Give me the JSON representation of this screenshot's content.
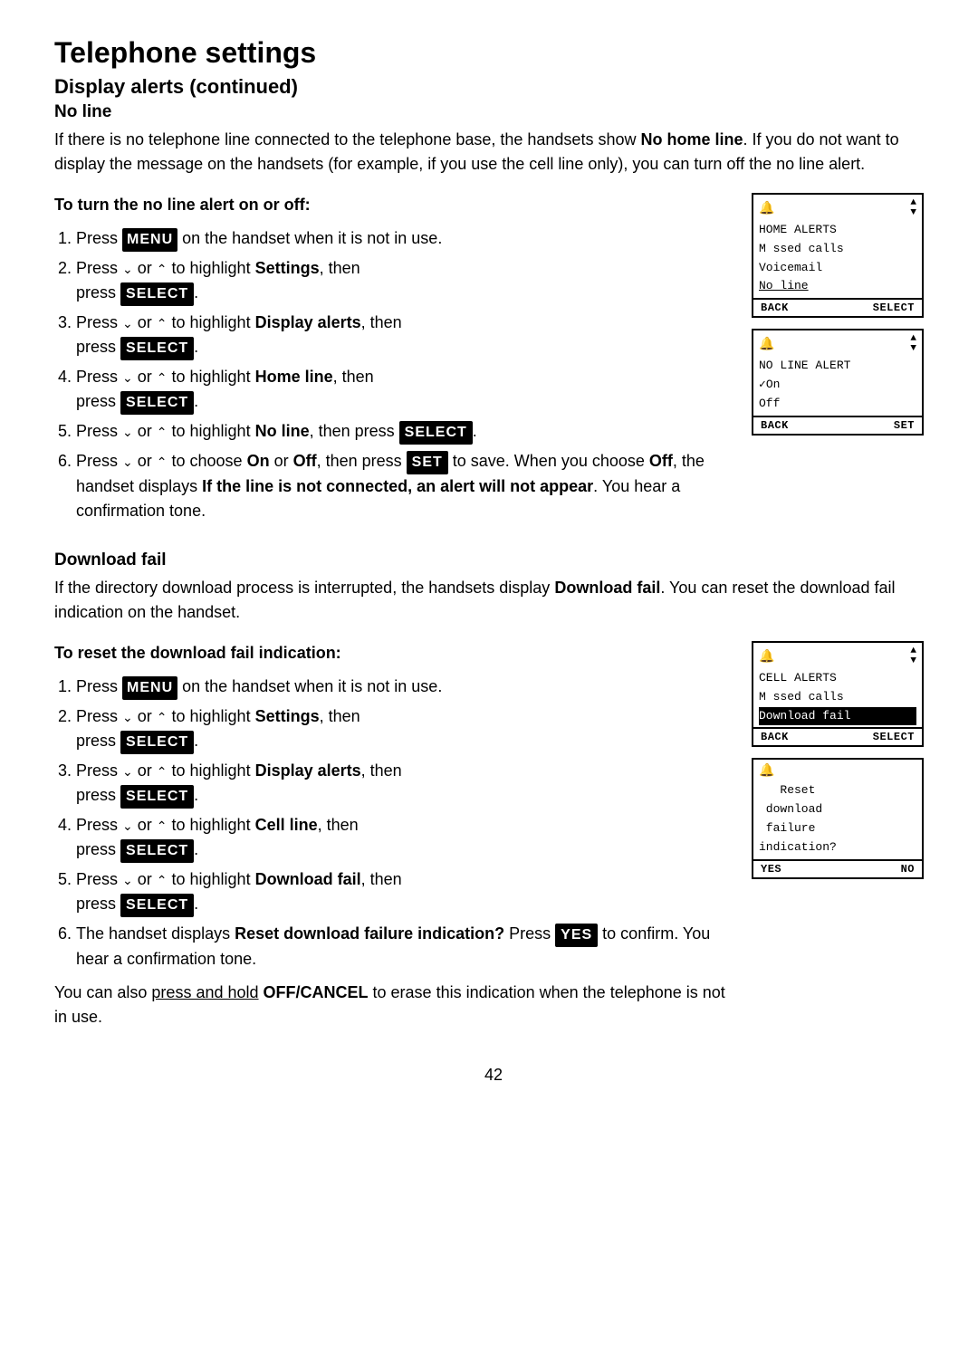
{
  "page": {
    "title": "Telephone settings",
    "subtitle": "Display alerts (continued)",
    "page_number": "42"
  },
  "no_line_section": {
    "heading": "No line",
    "intro": "If there is no telephone line connected to the telephone base, the handsets show",
    "intro_bold": "No home line",
    "intro_cont": ". If you do not want to display the message on the handsets (for example, if you use the cell line only), you can turn off the no line alert.",
    "subheading": "To turn the no line alert on or off:",
    "steps": [
      {
        "text": "Press ",
        "kbd": "MENU",
        "kbd_type": "menu",
        "after": " on the handset when it is not in use."
      },
      {
        "text": "Press ",
        "arrow": "down_up",
        "middle": " or ",
        "after_arrow": " to highlight ",
        "bold_word": "Settings",
        "after": ", then press ",
        "kbd": "SELECT",
        "kbd_type": "select",
        "dot": "."
      },
      {
        "text": "Press ",
        "arrow": "down_up",
        "middle": " or ",
        "after_arrow": " to highlight ",
        "bold_word": "Display alerts",
        "after": ", then press ",
        "kbd": "SELECT",
        "kbd_type": "select",
        "dot": "."
      },
      {
        "text": "Press ",
        "arrow": "down_up",
        "middle": " or ",
        "after_arrow": " to highlight ",
        "bold_word": "Home line",
        "after": ", then press ",
        "kbd": "SELECT",
        "kbd_type": "select",
        "dot": "."
      },
      {
        "text": "Press ",
        "arrow": "down_up",
        "middle": " or ",
        "after_arrow": " to highlight ",
        "bold_word": "No line",
        "after": ", then press ",
        "kbd": "SELECT",
        "kbd_type": "select",
        "dot": "."
      },
      {
        "text": "Press ",
        "arrow": "down_up",
        "middle": " or ",
        "after_arrow": " to choose ",
        "bold_word": "On",
        "after": " or ",
        "bold_word2": "Off",
        "after2": ", then press ",
        "kbd": "SET",
        "kbd_type": "set",
        "rest": " to save. When you choose ",
        "bold_rest": "Off",
        "rest2": ", the handset displays ",
        "bold_rest2": "If the line is not connected, an alert will not appear",
        "rest3": ". You hear a confirmation tone."
      }
    ],
    "screens": [
      {
        "id": "screen1",
        "has_bell": true,
        "has_arrows": true,
        "lines": [
          {
            "text": "HOME ALERTS",
            "style": "normal"
          },
          {
            "text": "M ssed calls",
            "style": "normal"
          },
          {
            "text": "Voicemail",
            "style": "normal"
          },
          {
            "text": "No line",
            "style": "underlined"
          }
        ],
        "footer_left": "BACK",
        "footer_right": "SELECT"
      },
      {
        "id": "screen2",
        "has_bell": true,
        "has_arrows": true,
        "lines": [
          {
            "text": "NO LINE ALERT",
            "style": "normal"
          },
          {
            "text": "✓On",
            "style": "normal"
          },
          {
            "text": "Off",
            "style": "normal"
          }
        ],
        "footer_left": "BACK",
        "footer_right": "SET"
      }
    ]
  },
  "download_fail_section": {
    "heading": "Download fail",
    "intro": "If the directory download process is interrupted, the handsets display",
    "intro_bold": "Download fail",
    "intro_cont": ". You can reset the download fail indication on the handset.",
    "subheading": "To reset the download fail indication:",
    "steps": [
      {
        "text": "Press ",
        "kbd": "MENU",
        "kbd_type": "menu",
        "after": " on the handset when it is not in use."
      },
      {
        "text": "Press ",
        "arrow": "down_up",
        "middle": " or ",
        "after_arrow": " to highlight ",
        "bold_word": "Settings",
        "after": ", then press ",
        "kbd": "SELECT",
        "kbd_type": "select",
        "dot": "."
      },
      {
        "text": "Press ",
        "arrow": "down_up",
        "middle": " or ",
        "after_arrow": " to highlight ",
        "bold_word": "Display alerts",
        "after": ", then press ",
        "kbd": "SELECT",
        "kbd_type": "select",
        "dot": "."
      },
      {
        "text": "Press ",
        "arrow": "down_up",
        "middle": " or ",
        "after_arrow": " to highlight ",
        "bold_word": "Cell line",
        "after": ", then press ",
        "kbd": "SELECT",
        "kbd_type": "select",
        "dot": "."
      },
      {
        "text": "Press ",
        "arrow": "down_up",
        "middle": " or ",
        "after_arrow": " to highlight ",
        "bold_word": "Download fail",
        "after": ", then press ",
        "kbd": "SELECT",
        "kbd_type": "select",
        "dot": "."
      },
      {
        "text": "The handset displays ",
        "bold_word": "Reset download failure indication?",
        "after": " Press ",
        "kbd": "YES",
        "kbd_type": "yes",
        "rest": " to confirm. You hear a confirmation tone."
      }
    ],
    "footer_note_text": "You can also ",
    "footer_note_underline": "press and hold",
    "footer_note_bold": " OFF/CANCEL",
    "footer_note_rest": " to erase this indication when the telephone is not in use.",
    "screens": [
      {
        "id": "screen3",
        "has_bell": true,
        "has_arrows": true,
        "lines": [
          {
            "text": "CELL ALERTS",
            "style": "normal"
          },
          {
            "text": "M ssed calls",
            "style": "normal"
          },
          {
            "text": "Download fail",
            "style": "highlighted"
          }
        ],
        "footer_left": "BACK",
        "footer_right": "SELECT"
      },
      {
        "id": "screen4",
        "has_bell": true,
        "has_arrows": false,
        "lines": [
          {
            "text": "   Reset",
            "style": "normal"
          },
          {
            "text": " download",
            "style": "normal"
          },
          {
            "text": " failure",
            "style": "normal"
          },
          {
            "text": "indication?",
            "style": "normal"
          }
        ],
        "footer_left": "YES",
        "footer_right": "NO"
      }
    ]
  }
}
